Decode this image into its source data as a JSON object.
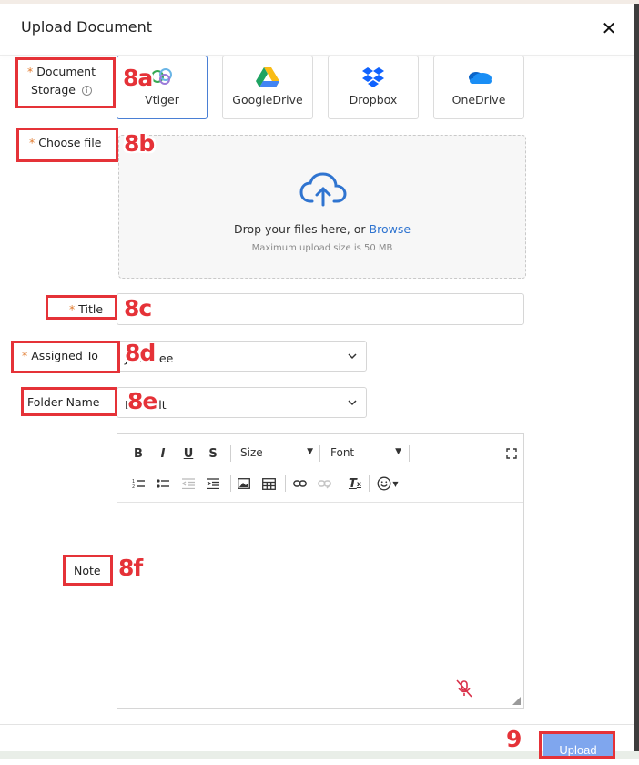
{
  "dialog": {
    "title": "Upload Document",
    "close_icon": "close-icon"
  },
  "document_storage": {
    "label_line1": "Document",
    "label_line2": "Storage",
    "required_mark": "*",
    "options": [
      {
        "label": "Vtiger",
        "icon": "vtiger-icon",
        "selected": true
      },
      {
        "label": "GoogleDrive",
        "icon": "google-drive-icon",
        "selected": false
      },
      {
        "label": "Dropbox",
        "icon": "dropbox-icon",
        "selected": false
      },
      {
        "label": "OneDrive",
        "icon": "onedrive-icon",
        "selected": false
      }
    ]
  },
  "choose_file": {
    "label": "Choose file",
    "required_mark": "*",
    "drop_text": "Drop your files here, or",
    "browse_text": "Browse",
    "hint": "Maximum upload size is 50 MB"
  },
  "title_field": {
    "label": "Title",
    "required_mark": "*",
    "value": ""
  },
  "assigned_to": {
    "label": "Assigned To",
    "required_mark": "*",
    "value": "John Lee"
  },
  "folder_name": {
    "label": "Folder Name",
    "value": "Default"
  },
  "note": {
    "label": "Note",
    "toolbar": {
      "size_label": "Size",
      "font_label": "Font"
    }
  },
  "footer": {
    "upload_label": "Upload"
  },
  "annotations": [
    "8a",
    "8b",
    "8c",
    "8d",
    "8e",
    "8f",
    "9"
  ],
  "colors": {
    "accent": "#2f74d0",
    "required": "#e07a2e",
    "annotation": "#e53238",
    "upload_button": "#7fa6ee"
  }
}
